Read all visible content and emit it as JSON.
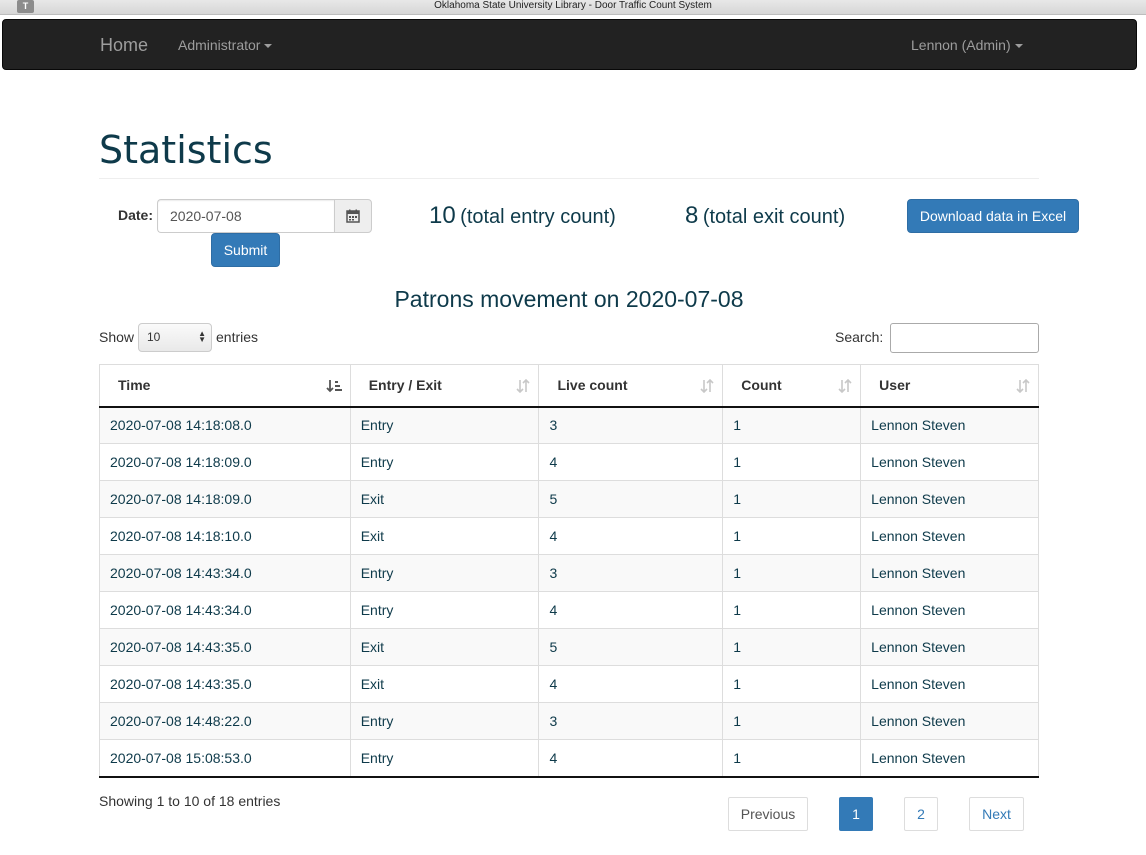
{
  "window": {
    "title": "Oklahoma State University Library - Door Traffic Count System"
  },
  "navbar": {
    "home": "Home",
    "admin_menu": "Administrator",
    "user_menu": "Lennon (Admin)"
  },
  "page": {
    "title": "Statistics"
  },
  "form": {
    "date_label": "Date:",
    "date_value": "2020-07-08",
    "submit_label": "Submit"
  },
  "totals": {
    "entry_count": "10",
    "entry_text": "(total entry count)",
    "exit_count": "8",
    "exit_text": "(total exit count)"
  },
  "excel_button": "Download data in Excel",
  "table_title": "Patrons movement on 2020-07-08",
  "controls": {
    "show_label": "Show",
    "page_length": "10",
    "entries_label": "entries",
    "search_label": "Search:"
  },
  "table": {
    "columns": [
      "Time",
      "Entry / Exit",
      "Live count",
      "Count",
      "User"
    ],
    "rows": [
      [
        "2020-07-08 14:18:08.0",
        "Entry",
        "3",
        "1",
        "Lennon Steven"
      ],
      [
        "2020-07-08 14:18:09.0",
        "Entry",
        "4",
        "1",
        "Lennon Steven"
      ],
      [
        "2020-07-08 14:18:09.0",
        "Exit",
        "5",
        "1",
        "Lennon Steven"
      ],
      [
        "2020-07-08 14:18:10.0",
        "Exit",
        "4",
        "1",
        "Lennon Steven"
      ],
      [
        "2020-07-08 14:43:34.0",
        "Entry",
        "3",
        "1",
        "Lennon Steven"
      ],
      [
        "2020-07-08 14:43:34.0",
        "Entry",
        "4",
        "1",
        "Lennon Steven"
      ],
      [
        "2020-07-08 14:43:35.0",
        "Exit",
        "5",
        "1",
        "Lennon Steven"
      ],
      [
        "2020-07-08 14:43:35.0",
        "Exit",
        "4",
        "1",
        "Lennon Steven"
      ],
      [
        "2020-07-08 14:48:22.0",
        "Entry",
        "3",
        "1",
        "Lennon Steven"
      ],
      [
        "2020-07-08 15:08:53.0",
        "Entry",
        "4",
        "1",
        "Lennon Steven"
      ]
    ]
  },
  "footer": {
    "info": "Showing 1 to 10 of 18 entries",
    "previous": "Previous",
    "page1": "1",
    "page2": "2",
    "next": "Next"
  },
  "colors": {
    "navbar": "#222222",
    "primary": "#337ab7",
    "heading": "#0e3a4a"
  }
}
